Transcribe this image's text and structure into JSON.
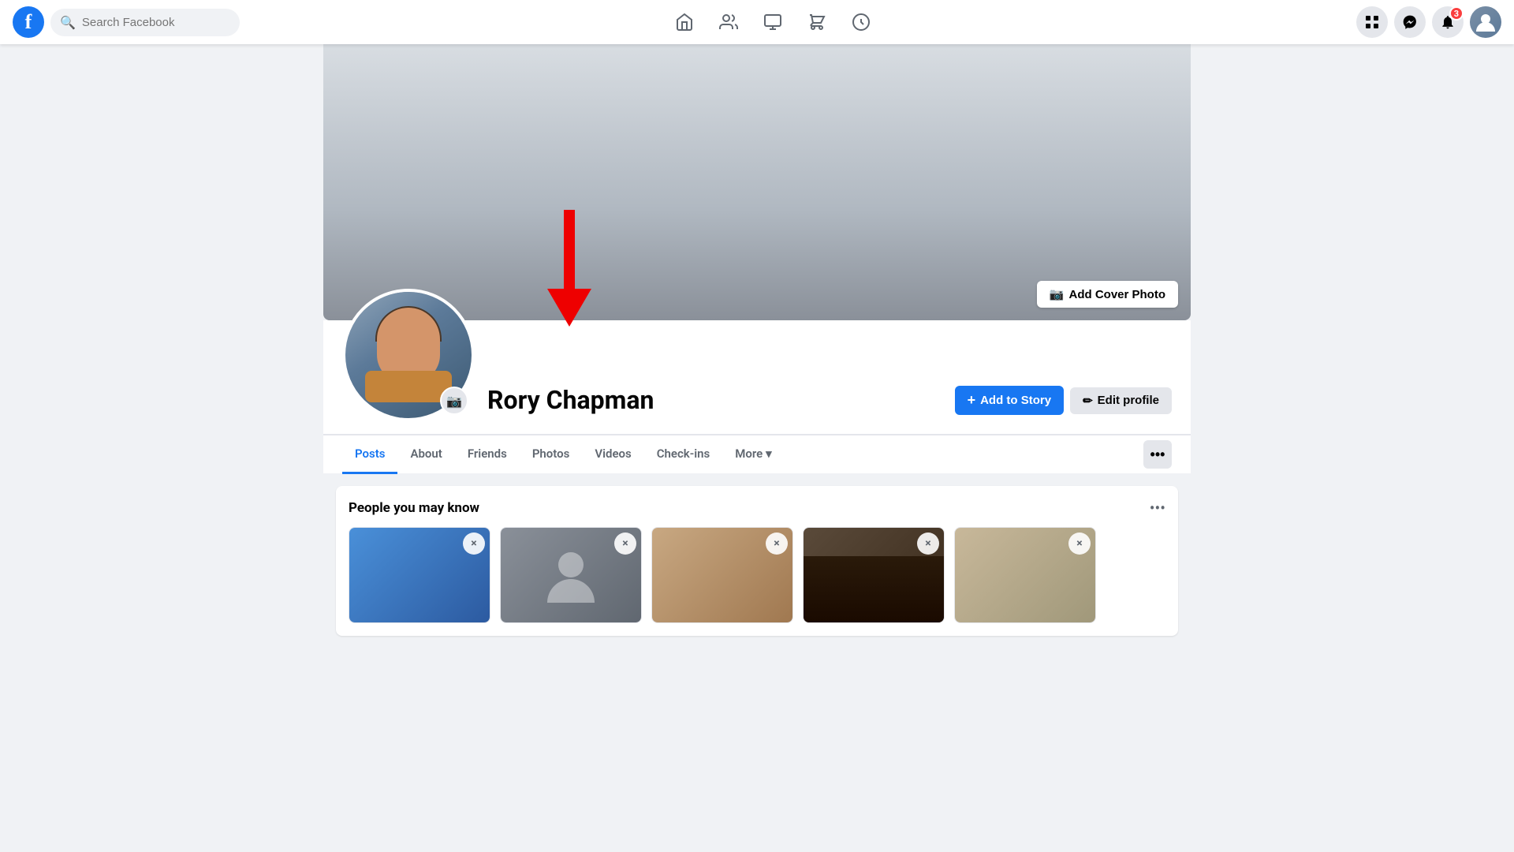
{
  "app": {
    "name": "Facebook",
    "logo_letter": "f"
  },
  "topnav": {
    "search_placeholder": "Search Facebook",
    "nav_icons": [
      {
        "name": "home-icon",
        "symbol": "⌂",
        "active": false
      },
      {
        "name": "friends-icon",
        "symbol": "👥",
        "active": false
      },
      {
        "name": "video-icon",
        "symbol": "▶",
        "active": false
      },
      {
        "name": "marketplace-icon",
        "symbol": "🏪",
        "active": false
      },
      {
        "name": "groups-icon",
        "symbol": "🌐",
        "active": false
      }
    ],
    "right_icons": [
      {
        "name": "grid-icon",
        "symbol": "⠿"
      },
      {
        "name": "messenger-icon",
        "symbol": "💬"
      },
      {
        "name": "notifications-icon",
        "symbol": "🔔",
        "badge": "3"
      }
    ]
  },
  "profile": {
    "name": "Rory Chapman",
    "cover_photo_label": "Add Cover Photo",
    "add_story_label": "Add to Story",
    "edit_profile_label": "Edit profile",
    "camera_icon": "📷"
  },
  "tabs": [
    {
      "label": "Posts",
      "active": true
    },
    {
      "label": "About",
      "active": false
    },
    {
      "label": "Friends",
      "active": false
    },
    {
      "label": "Photos",
      "active": false
    },
    {
      "label": "Videos",
      "active": false
    },
    {
      "label": "Check-ins",
      "active": false
    },
    {
      "label": "More",
      "active": false,
      "has_arrow": true
    }
  ],
  "people_section": {
    "title": "People you may know",
    "people": [
      {
        "bg_class": "photo-blue"
      },
      {
        "bg_class": "photo-gray"
      },
      {
        "bg_class": "photo-tan"
      },
      {
        "bg_class": "photo-dark"
      },
      {
        "bg_class": "photo-map"
      }
    ]
  },
  "icons": {
    "plus": "+",
    "pencil": "✏",
    "camera": "📷",
    "chevron_down": "▾",
    "three_dots": "···",
    "close": "×",
    "search": "🔍"
  }
}
